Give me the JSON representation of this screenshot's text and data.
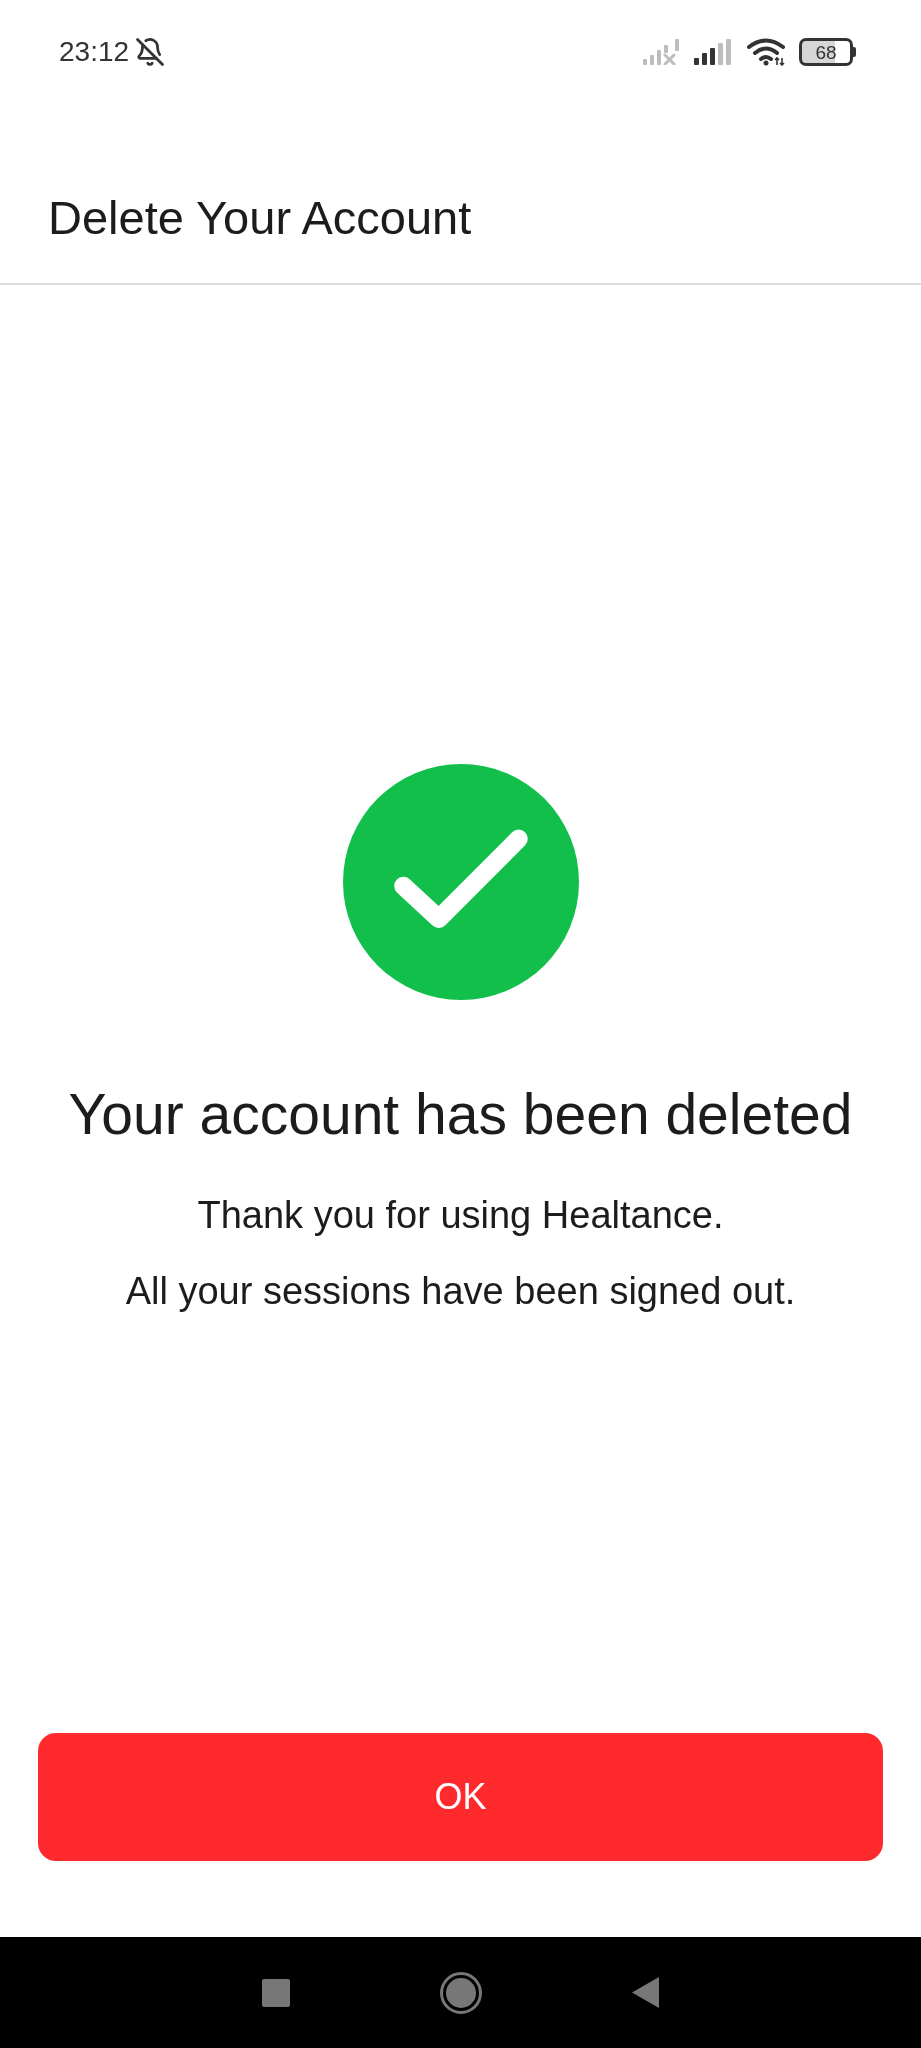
{
  "status_bar": {
    "time": "23:12",
    "battery": "68"
  },
  "app_bar": {
    "title": "Delete Your Account"
  },
  "confirmation": {
    "heading": "Your account has been deleted",
    "lines": [
      "Thank you for using Healtance.",
      "All your sessions have been signed out."
    ]
  },
  "ok_button": {
    "label": "OK"
  }
}
